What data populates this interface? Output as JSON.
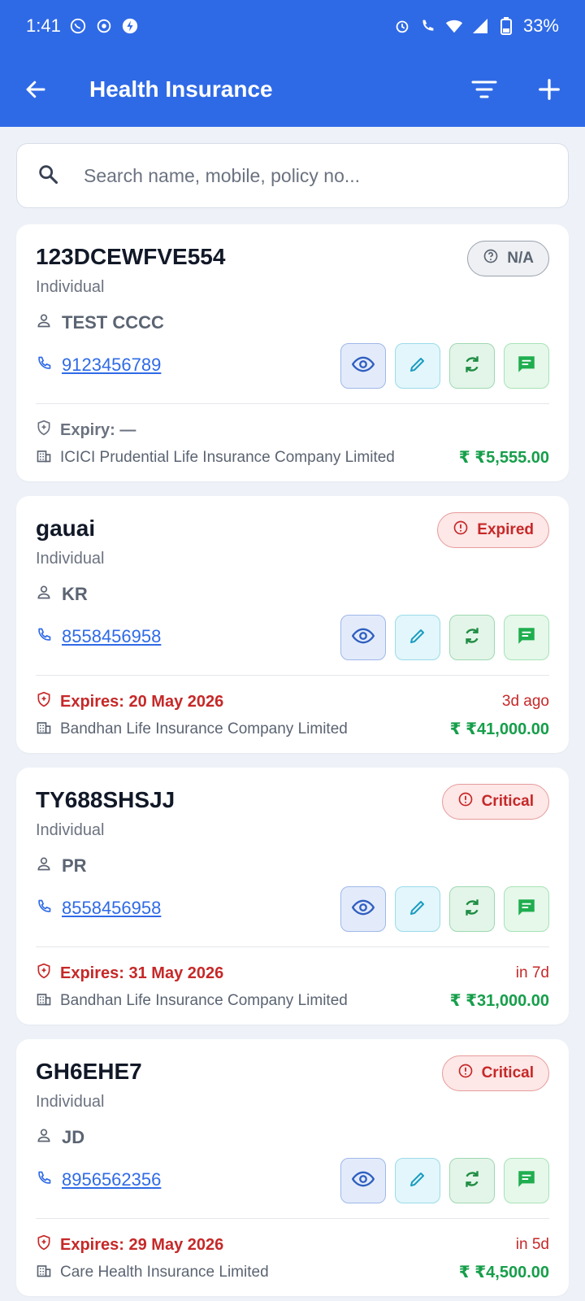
{
  "status_bar": {
    "time": "1:41",
    "battery": "33%"
  },
  "app_bar": {
    "title": "Health Insurance"
  },
  "search": {
    "placeholder": "Search name, mobile, policy no..."
  },
  "colors": {
    "primary": "#2f6ae6",
    "danger": "#c62828",
    "success": "#169e4a"
  },
  "cards": [
    {
      "policy_no": "123DCEWFVE554",
      "type": "Individual",
      "holder": "TEST CCCC",
      "phone": "9123456789",
      "badge": "N/A",
      "expiry": "Expiry: —",
      "relative": "",
      "insurer": "ICICI Prudential Life Insurance Company Limited",
      "premium": "₹ ₹5,555.00"
    },
    {
      "policy_no": "gauai",
      "type": "Individual",
      "holder": "KR",
      "phone": "8558456958",
      "badge": "Expired",
      "expiry": "Expires: 20 May 2026",
      "relative": "3d ago",
      "insurer": "Bandhan Life Insurance Company Limited",
      "premium": "₹ ₹41,000.00"
    },
    {
      "policy_no": "TY688SHSJJ",
      "type": "Individual",
      "holder": "PR",
      "phone": "8558456958",
      "badge": "Critical",
      "expiry": "Expires: 31 May 2026",
      "relative": "in 7d",
      "insurer": "Bandhan Life Insurance Company Limited",
      "premium": "₹ ₹31,000.00"
    },
    {
      "policy_no": "GH6EHE7",
      "type": "Individual",
      "holder": "JD",
      "phone": "8956562356",
      "badge": "Critical",
      "expiry": "Expires: 29 May 2026",
      "relative": "in 5d",
      "insurer": "Care Health Insurance Limited",
      "premium": "₹ ₹4,500.00"
    }
  ]
}
